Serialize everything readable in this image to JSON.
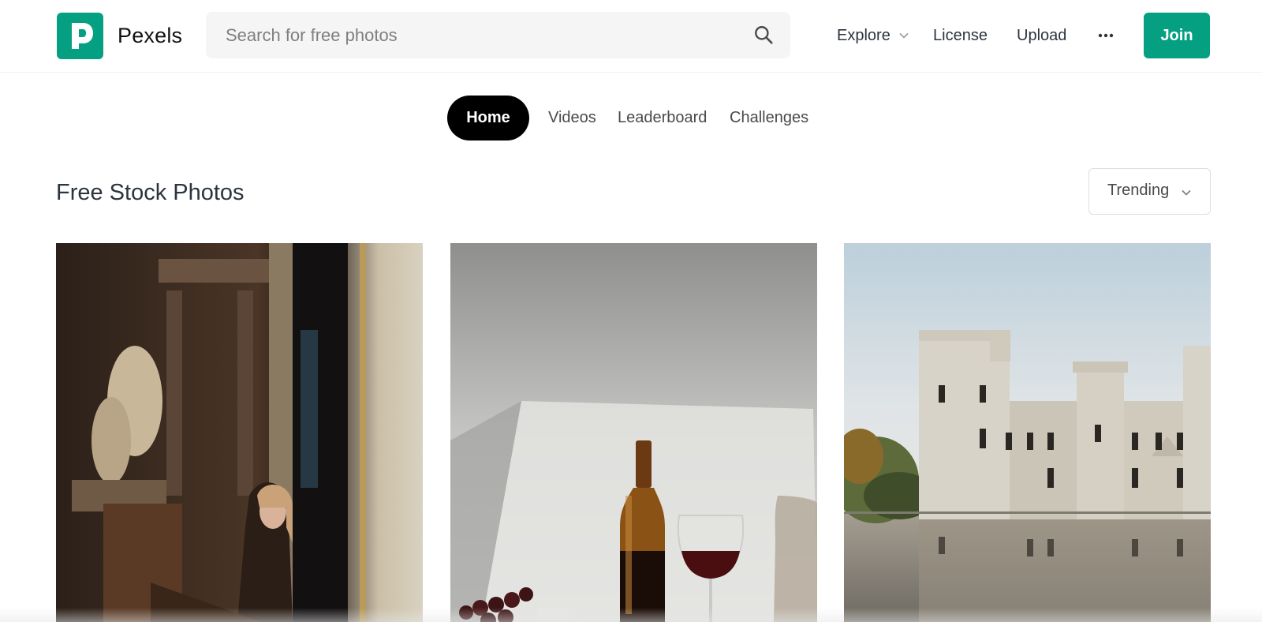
{
  "header": {
    "brand": "Pexels",
    "search_placeholder": "Search for free photos",
    "nav": {
      "explore": "Explore",
      "license": "License",
      "upload": "Upload"
    },
    "join_label": "Join"
  },
  "tabs": [
    {
      "label": "Home",
      "active": true
    },
    {
      "label": "Videos",
      "active": false
    },
    {
      "label": "Leaderboard",
      "active": false
    },
    {
      "label": "Challenges",
      "active": false
    }
  ],
  "main": {
    "title": "Free Stock Photos",
    "sort_value": "Trending"
  },
  "colors": {
    "brand": "#05a081",
    "active_tab": "#000000",
    "text": "#2c343e"
  },
  "icons": [
    "pexels-logo-icon",
    "search-icon",
    "chevron-down-icon",
    "more-dots-icon"
  ]
}
